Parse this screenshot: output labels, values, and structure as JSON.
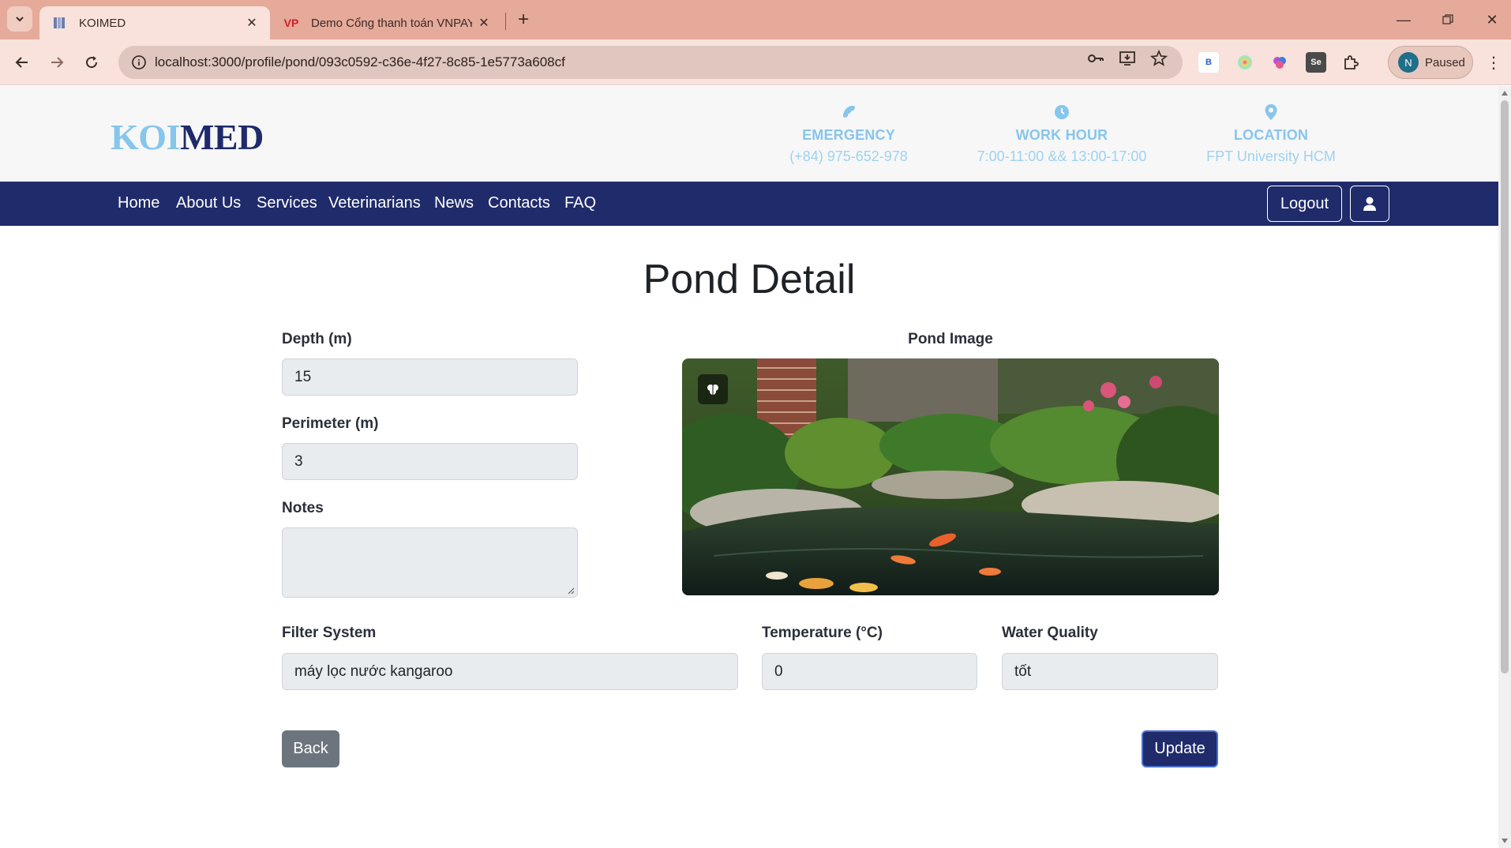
{
  "browser": {
    "tabs": [
      {
        "title": "KOIMED",
        "active": true
      },
      {
        "title": "Demo Cổng thanh toán VNPAY",
        "active": false,
        "favicon_text": "VP"
      }
    ],
    "url": "localhost:3000/profile/pond/093c0592-c36e-4f27-8c85-1e5773a608cf",
    "extensions": [
      "B",
      "Se"
    ],
    "profile": {
      "initial": "N",
      "status": "Paused"
    }
  },
  "site": {
    "logo": {
      "part1": "KOI",
      "part2": "MED"
    },
    "info": [
      {
        "icon": "phone-icon",
        "label": "EMERGENCY",
        "value": "(+84) 975-652-978"
      },
      {
        "icon": "clock-icon",
        "label": "WORK HOUR",
        "value": "7:00-11:00 && 13:00-17:00"
      },
      {
        "icon": "location-pin-icon",
        "label": "LOCATION",
        "value": "FPT University HCM"
      }
    ],
    "nav": [
      "Home",
      "About Us",
      "Services",
      "Veterinarians",
      "News",
      "Contacts",
      "FAQ"
    ],
    "logout_label": "Logout"
  },
  "pond": {
    "title": "Pond Detail",
    "depth_label": "Depth (m)",
    "depth": "15",
    "perimeter_label": "Perimeter (m)",
    "perimeter": "3",
    "notes_label": "Notes",
    "notes": "",
    "image_label": "Pond Image",
    "filter_label": "Filter System",
    "filter": "máy lọc nước kangaroo",
    "temperature_label": "Temperature (°C)",
    "temperature": "0",
    "water_quality_label": "Water Quality",
    "water_quality": "tốt",
    "back_label": "Back",
    "update_label": "Update"
  },
  "colors": {
    "navy": "#1f2b6a",
    "light_blue": "#86c6ec",
    "tab_bar": "#e5aa99",
    "back_button": "#6c757d"
  }
}
